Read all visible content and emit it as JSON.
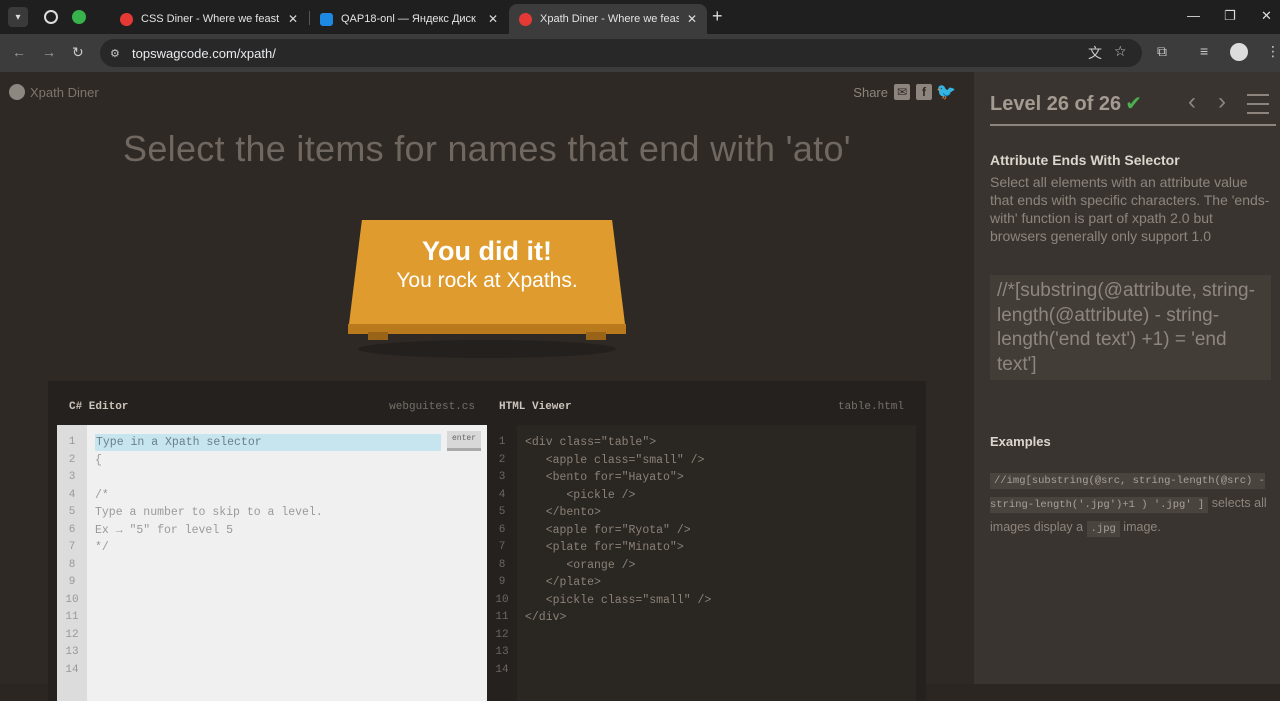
{
  "browser": {
    "tabs": [
      {
        "title": "CSS Diner - Where we feast on",
        "favicon_color": "#e53935",
        "active": false
      },
      {
        "title": "QAP18-onl — Яндекс Диск",
        "favicon_color": "#1e88e5",
        "active": false
      },
      {
        "title": "Xpath Diner - Where we feast o",
        "favicon_color": "#e53935",
        "active": true
      }
    ],
    "url": "topswagcode.com/xpath/"
  },
  "page": {
    "logo": "Xpath Diner",
    "share_label": "Share",
    "instruction": "Select the items for names that end with 'ato'",
    "success": {
      "line1": "You did it!",
      "line2": "You rock at Xpaths."
    }
  },
  "editor": {
    "name": "C# Editor",
    "file": "webguitest.cs",
    "placeholder": "Type in a Xpath selector",
    "enter_label": "enter",
    "line_numbers": [
      "1",
      "2",
      "3",
      "4",
      "5",
      "6",
      "7",
      "8",
      "9",
      "10",
      "11",
      "12",
      "13",
      "14"
    ],
    "lines": [
      "{",
      "",
      "/*",
      "Type a number to skip to a level.",
      "Ex → \"5\" for level 5",
      "*/"
    ]
  },
  "viewer": {
    "name": "HTML Viewer",
    "file": "table.html",
    "line_numbers": [
      "1",
      "2",
      "3",
      "4",
      "5",
      "6",
      "7",
      "8",
      "9",
      "10",
      "11",
      "12",
      "13",
      "14"
    ],
    "lines": [
      "<div class=\"table\">",
      "   <apple class=\"small\" />",
      "   <bento for=\"Hayato\">",
      "      <pickle />",
      "   </bento>",
      "   <apple for=\"Ryota\" />",
      "   <plate for=\"Minato\">",
      "      <orange />",
      "   </plate>",
      "   <pickle class=\"small\" />",
      "</div>"
    ]
  },
  "sidebar": {
    "level": "Level 26 of 26",
    "progress": 1.0,
    "selector_name": "Attribute Ends With Selector",
    "description": "Select all elements with an attribute value that ends with specific characters. The 'ends-with' function is part of xpath 2.0 but browsers generally only support 1.0",
    "syntax": "//*[substring(@attribute, string-length(@attribute) - string-length('end text') +1) = 'end text']",
    "examples_title": "Examples",
    "example_code": "//img[substring(@src, string-length(@src) - string-length('.jpg')+1 ) '.jpg' ]",
    "example_text1": "selects all images display a",
    "example_code2": ".jpg",
    "example_text2": "image."
  }
}
